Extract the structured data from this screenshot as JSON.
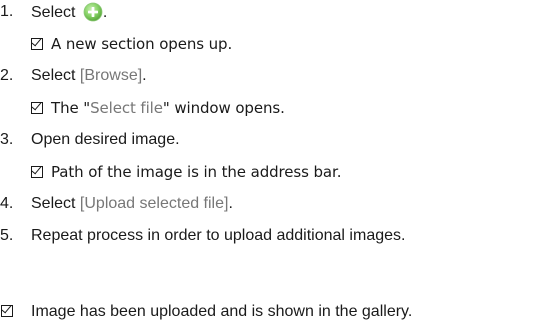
{
  "steps": [
    {
      "number": "1.",
      "text_before": "Select ",
      "icon": "add-circle-icon",
      "text_after": ".",
      "result": "A new section opens up."
    },
    {
      "number": "2.",
      "text_before": "Select ",
      "ui_term": "[Browse]",
      "text_after": ".",
      "result_before": "The \"",
      "result_term": "Select file",
      "result_after": "\" window opens."
    },
    {
      "number": "3.",
      "text": "Open desired image.",
      "result": "Path of the image is in the address bar."
    },
    {
      "number": "4.",
      "text_before": "Select ",
      "ui_term": "[Upload selected file]",
      "text_after": "."
    },
    {
      "number": "5.",
      "text": "Repeat process in order to upload additional images."
    }
  ],
  "final_result": "Image has been uploaded and is shown in the gallery.",
  "colors": {
    "text": "#1a1a1a",
    "ui_term": "#777777",
    "icon_green": "#6cc04a"
  }
}
